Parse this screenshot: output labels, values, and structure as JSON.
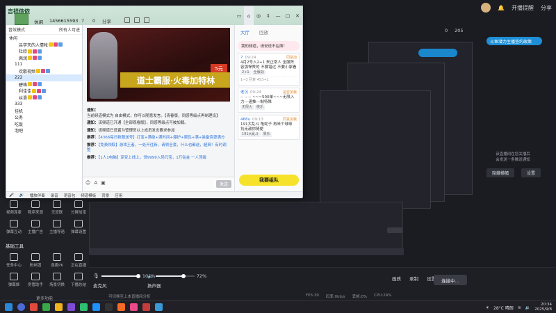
{
  "taskbar": {
    "time": "20:34",
    "date": "2025/9/8",
    "weather": "28°C 晴朗"
  },
  "background": {
    "tools_grid": [
      {
        "label": "视频连麦",
        "icon": "video-link-icon"
      },
      {
        "label": "程序来源",
        "icon": "program-icon"
      },
      {
        "label": "无双联",
        "icon": "multi-icon"
      },
      {
        "label": "分屏加宝",
        "icon": "split-icon"
      },
      {
        "label": "弹幕互动",
        "icon": "danmaku-icon"
      },
      {
        "label": "主播广告",
        "icon": "ad-icon"
      },
      {
        "label": "主播导语",
        "icon": "tip-icon"
      },
      {
        "label": "弹幕设置",
        "icon": "danmaku-settings-icon"
      }
    ],
    "basic_tools_title": "基础工具",
    "basic_tools": [
      {
        "label": "任务中心",
        "icon": "task-icon"
      },
      {
        "label": "粉丝团",
        "icon": "fans-icon"
      },
      {
        "label": "连麦PK",
        "icon": "pk-icon"
      },
      {
        "label": "正在直播",
        "icon": "live-icon"
      },
      {
        "label": "弹幕姬",
        "icon": "danmaku-girl-icon"
      },
      {
        "label": "房管助手",
        "icon": "manager-icon"
      },
      {
        "label": "场景切换",
        "icon": "scene-icon"
      },
      {
        "label": "下播总结",
        "icon": "summary-icon"
      }
    ],
    "more_label": "更多功能",
    "mic_label": "麦克风",
    "mic_volume": "104%",
    "speaker_label": "扬声器",
    "speaker_volume": "72%",
    "go_live_label": "连接中...",
    "status_items": [
      "FPS:30",
      "码率:0kb/s",
      "丢帧:0%",
      "CPU:24%"
    ],
    "right_labels": [
      "画质",
      "录制",
      "设置"
    ],
    "top_right": [
      "开播提醒",
      "分享"
    ],
    "top_right_counts": [
      "0",
      "205"
    ],
    "promo": "斗鱼潜力主播签约政策",
    "notice_line1": "该直播间在您关播后",
    "notice_line2": "会发送一条推送通知",
    "notice_btn1": "隐藏横幅",
    "notice_btn2": "设置",
    "bottom_tip": "可切换至上本直播间分析"
  },
  "yy": {
    "logo": "吉祥侬侬",
    "channel_name": "休闲",
    "channel_id": "1456615593",
    "users": "7",
    "users2": "0",
    "share": "分享",
    "left_tools": [
      "音效模式",
      "所有人可进"
    ],
    "tree": [
      {
        "name": "休闲",
        "level": "root",
        "active": false
      },
      {
        "name": "吕学天的人情帐",
        "level": "user",
        "active": false
      },
      {
        "name": "杜欣",
        "level": "user",
        "active": false
      },
      {
        "name": "佩润",
        "level": "user",
        "active": false
      },
      {
        "name": "111",
        "level": "sub",
        "active": false
      },
      {
        "name": "欢歌视频",
        "level": "user",
        "active": false
      },
      {
        "name": "222",
        "level": "sub",
        "active": true
      },
      {
        "name": "碧格",
        "level": "user",
        "active": false
      },
      {
        "name": "利佳佳",
        "level": "user",
        "active": false
      },
      {
        "name": "丝滑",
        "level": "user",
        "active": false
      },
      {
        "name": "333",
        "level": "sub",
        "active": false
      },
      {
        "name": "挂机",
        "level": "sub",
        "active": false
      },
      {
        "name": "公务",
        "level": "sub",
        "active": false
      },
      {
        "name": "吃饭",
        "level": "sub",
        "active": false
      },
      {
        "name": "泡吧",
        "level": "sub",
        "active": false
      }
    ],
    "banner_title": "道士霸服·火毒加特林",
    "banner_badge": "5元",
    "messages": [
      {
        "prefix": "通知：",
        "text": "当前频道模式为 自由模式，你可以随意发言。【青春版，同感等级点再制理设】"
      },
      {
        "prefix": "通知：",
        "text": "该频道已开通【全部观看版】，同感等级点可被加载。"
      },
      {
        "prefix": "通知：",
        "text": "该频道已设置为管理员以上成员发言要求参加"
      },
      {
        "prefix": "推荐：",
        "text": "【4366每日新服送号】打宝+满级+满时间+爆护+属性+满+装备资源满分"
      },
      {
        "prefix": "推荐：",
        "text": "【免费领取】游戏王者，一处开往新，请领全套，什么也都送，超爽！有时调整"
      },
      {
        "prefix": "推荐：",
        "text": "【1人1电脑】享受上线上，领9999入场元宝，1万钻金 一人顶级"
      }
    ],
    "send_label": "发送",
    "right_tabs": [
      "大厅",
      "回放"
    ],
    "cards": [
      {
        "who": "7",
        "time": "09:24",
        "follow": "同意加",
        "text": "4月2号入2+1 来正常人 全服阵容强悍赞的 不要错过 不要小家看",
        "tags": [
          "2+1",
          "全服战"
        ],
        "reply": "1→3   回复 453→1"
      },
      {
        "who": "老沉",
        "time": "09:24",
        "follow": "是否加我",
        "text": "-- -- -- ~~~500单~~~无限入力---速推---制特殊",
        "tags": [
          "无限火",
          "桃乐"
        ],
        "reply": ""
      },
      {
        "who": "468u",
        "time": "09:13",
        "follow": "同意加我",
        "text": "191大乱斗 龟蛇子 再来个球球 抗无敌你随便",
        "tags": [
          "191大乱斗",
          "果乐"
        ],
        "reply": ""
      }
    ],
    "pink_bar": "我的频道，请说说不在面！",
    "cta": "我要组队",
    "bottom_items": [
      "播放伴奏",
      "录音",
      "语音包",
      "频道模板",
      "背景",
      "应用"
    ]
  }
}
